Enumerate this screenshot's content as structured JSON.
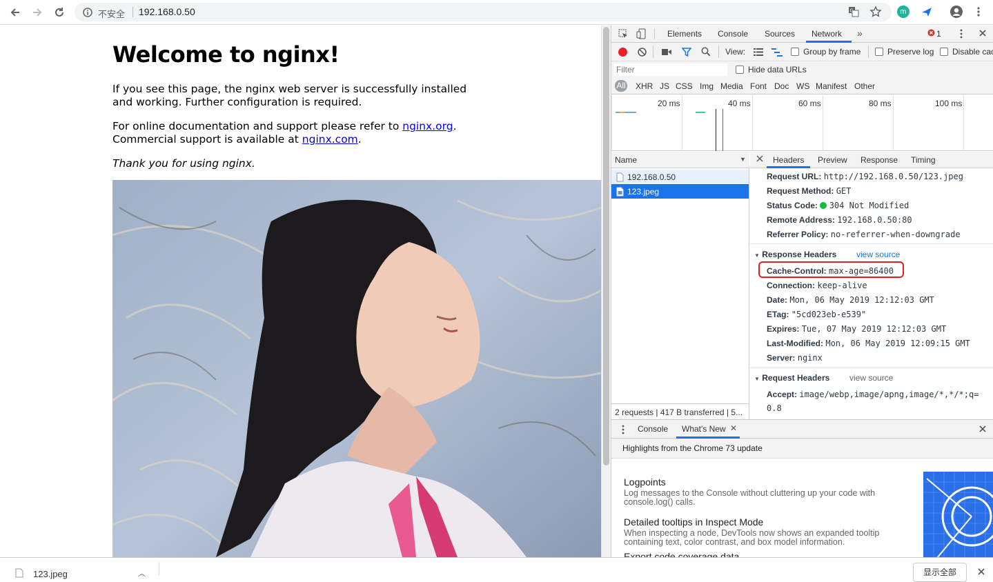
{
  "browser": {
    "security_label": "不安全",
    "url": "192.168.0.50"
  },
  "page": {
    "heading": "Welcome to nginx!",
    "para1": "If you see this page, the nginx web server is successfully installed and working. Further configuration is required.",
    "para2_prefix": "For online documentation and support please refer to ",
    "link1": "nginx.org",
    "para2_mid": ".",
    "para2_line2": "Commercial support is available at ",
    "link2": "nginx.com",
    "para2_end": ".",
    "thanks": "Thank you for using nginx."
  },
  "devtools": {
    "tabs": [
      "Elements",
      "Console",
      "Sources",
      "Network"
    ],
    "active_tab": "Network",
    "error_count": "1",
    "view_label": "View:",
    "group_by_frame": "Group by frame",
    "preserve_log": "Preserve log",
    "disable_cache": "Disable cac",
    "filter_placeholder": "Filter",
    "hide_data_urls": "Hide data URLs",
    "types": [
      "All",
      "XHR",
      "JS",
      "CSS",
      "Img",
      "Media",
      "Font",
      "Doc",
      "WS",
      "Manifest",
      "Other"
    ],
    "timeline_ticks": [
      "20 ms",
      "40 ms",
      "60 ms",
      "80 ms",
      "100 ms"
    ],
    "name_header": "Name",
    "requests": [
      "192.168.0.50",
      "123.jpeg"
    ],
    "summary": "2 requests | 417 B transferred | 5...",
    "detail_tabs": [
      "Headers",
      "Preview",
      "Response",
      "Timing"
    ],
    "general": [
      {
        "k": "Request URL:",
        "v": "http://192.168.0.50/123.jpeg"
      },
      {
        "k": "Request Method:",
        "v": "GET"
      },
      {
        "k": "Status Code:",
        "v": "304 Not Modified"
      },
      {
        "k": "Remote Address:",
        "v": "192.168.0.50:80"
      },
      {
        "k": "Referrer Policy:",
        "v": "no-referrer-when-downgrade"
      }
    ],
    "response_headers_title": "Response Headers",
    "view_source": "view source",
    "response_headers": [
      {
        "k": "Cache-Control:",
        "v": "max-age=86400"
      },
      {
        "k": "Connection:",
        "v": "keep-alive"
      },
      {
        "k": "Date:",
        "v": "Mon, 06 May 2019 12:12:03 GMT"
      },
      {
        "k": "ETag:",
        "v": "\"5cd023eb-e539\""
      },
      {
        "k": "Expires:",
        "v": "Tue, 07 May 2019 12:12:03 GMT"
      },
      {
        "k": "Last-Modified:",
        "v": "Mon, 06 May 2019 12:09:15 GMT"
      },
      {
        "k": "Server:",
        "v": "nginx"
      }
    ],
    "request_headers_title": "Request Headers",
    "accept_key": "Accept:",
    "accept_val1": "image/webp,image/apng,image/*,*/*;q=",
    "accept_val2": "0.8",
    "drawer_tabs": [
      "Console",
      "What's New"
    ],
    "highlights": "Highlights from the Chrome 73 update",
    "news": [
      {
        "title": "Logpoints",
        "desc": "Log messages to the Console without cluttering up your code with console.log() calls."
      },
      {
        "title": "Detailed tooltips in Inspect Mode",
        "desc": "When inspecting a node, DevTools now shows an expanded tooltip containing text, color contrast, and box model information."
      },
      {
        "title": "Export code coverage data",
        "desc": ""
      }
    ]
  },
  "download": {
    "file": "123.jpeg",
    "show_all": "显示全部"
  },
  "colors": {
    "accent": "#1a73e8",
    "highlight_box": "#e02020",
    "selected_row": "#1a73e8"
  }
}
